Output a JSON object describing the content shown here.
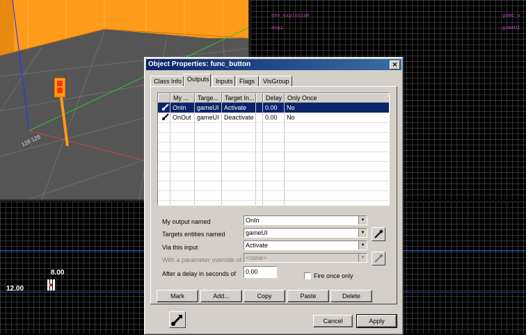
{
  "viewport_3d": {
    "floor_label": "128 128"
  },
  "viewport_topright": {
    "entity_labels": [
      "env_explosion",
      "exp1",
      "game_u",
      "gameUI"
    ]
  },
  "viewport_bottom": {
    "dim_height": "8.00",
    "dim_width": "12.00"
  },
  "dialog": {
    "title": "Object Properties: func_button",
    "close_glyph": "✕",
    "tabs": [
      "Class Info",
      "Outputs",
      "Inputs",
      "Flags",
      "VisGroup"
    ],
    "active_tab": "Outputs",
    "list": {
      "columns": [
        "My ...",
        "Targe...",
        "Target In...",
        "Delay",
        "Only Once"
      ],
      "rows": [
        {
          "output": "OnIn",
          "target": "gameUI",
          "input": "Activate",
          "delay": "0.00",
          "once": "No",
          "selected": true
        },
        {
          "output": "OnOut",
          "target": "gameUI",
          "input": "Deactivate",
          "delay": "0.00",
          "once": "No",
          "selected": false
        }
      ]
    },
    "form": {
      "output_label": "My output named",
      "output_value": "OnIn",
      "targets_label": "Targets entities named",
      "targets_value": "gameUI",
      "input_label": "Via this input",
      "input_value": "Activate",
      "param_label": "With a parameter override of",
      "param_value": "<none>",
      "delay_label": "After a delay in seconds of",
      "delay_value": "0.00",
      "fire_once_label": "Fire once only"
    },
    "buttons": {
      "mark": "Mark",
      "add": "Add...",
      "copy": "Copy",
      "paste": "Paste",
      "delete": "Delete",
      "cancel": "Cancel",
      "apply": "Apply"
    }
  }
}
